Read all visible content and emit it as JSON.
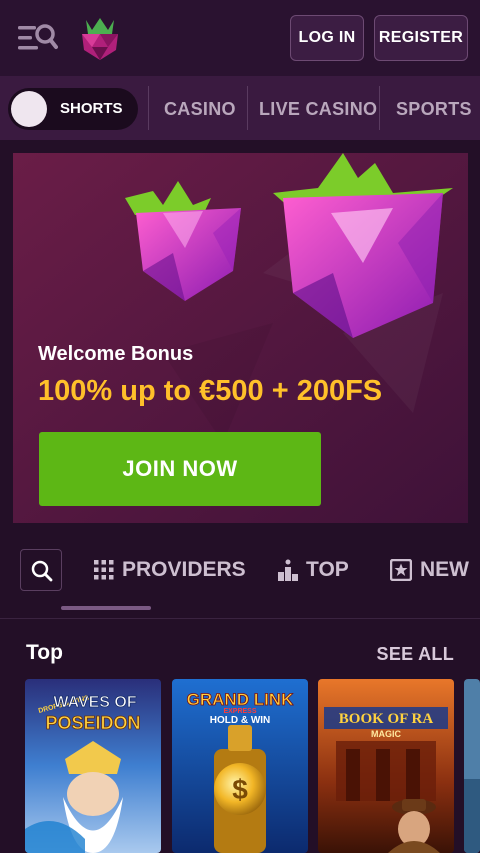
{
  "header": {
    "login_label": "LOG IN",
    "register_label": "REGISTER"
  },
  "nav": {
    "shorts_label": "SHORTS",
    "items": [
      "CASINO",
      "LIVE CASINO",
      "SPORTS"
    ]
  },
  "banner": {
    "subtitle": "Welcome Bonus",
    "headline": "100% up to €500 + 200FS",
    "cta_label": "JOIN NOW"
  },
  "tabs": {
    "providers": "PROVIDERS",
    "top": "TOP",
    "new": "NEW"
  },
  "top_section": {
    "title": "Top",
    "see_all": "SEE ALL",
    "games": [
      {
        "title_line1": "WAVES OF",
        "title_line2": "POSEIDON",
        "tag": "DROPS & WINS"
      },
      {
        "title_line1": "GRAND LINK",
        "title_line2": "HOLD & WIN",
        "tag": "EXPRESS"
      },
      {
        "title_line1": "BOOK OF RA",
        "title_line2": "MAGIC",
        "tag": ""
      }
    ]
  },
  "colors": {
    "background": "#230f27",
    "header": "#2a1230",
    "nav": "#3a1a40",
    "banner": "#5b1a3f",
    "cta_green": "#5db715",
    "headline_gold": "#ffc02a"
  }
}
